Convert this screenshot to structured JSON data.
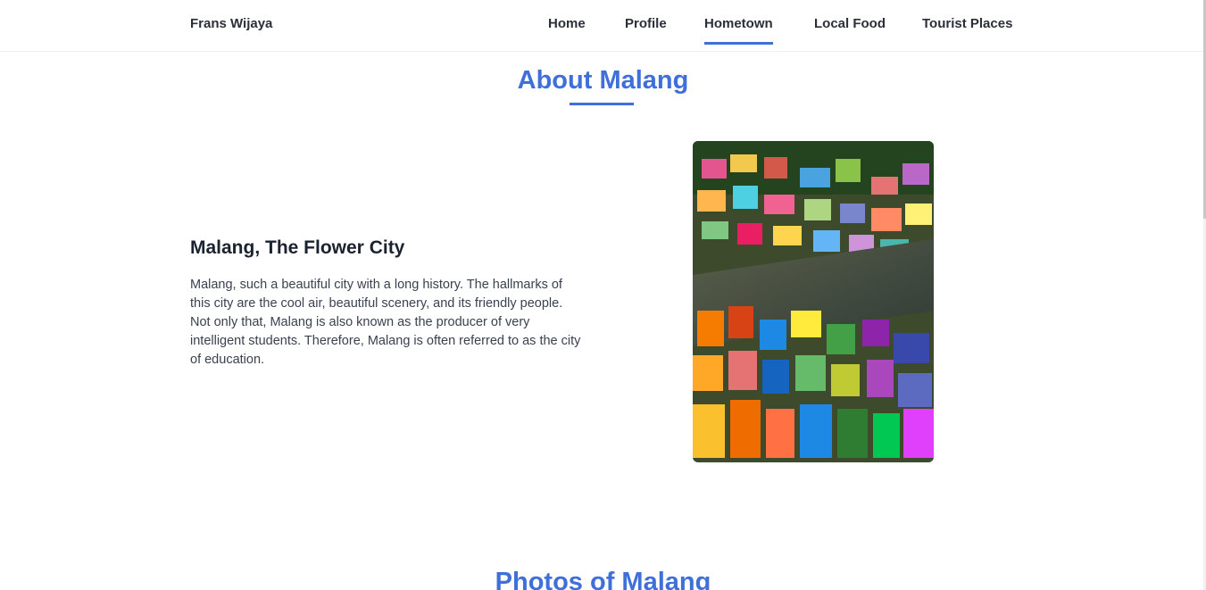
{
  "brand": "Frans Wijaya",
  "nav": {
    "items": [
      {
        "label": "Home",
        "active": false
      },
      {
        "label": "Profile",
        "active": false
      },
      {
        "label": "Hometown",
        "active": true
      },
      {
        "label": "Local Food",
        "active": false
      },
      {
        "label": "Tourist Places",
        "active": false
      }
    ]
  },
  "about": {
    "title": "About Malang",
    "heading": "Malang, The Flower City",
    "text": "Malang, such a beautiful city with a long history. The hallmarks of this city are the cool air, beautiful scenery, and its friendly people. Not only that, Malang is also known as the producer of very intelligent students. Therefore, Malang is often referred to as the city of education."
  },
  "photos": {
    "title": "Photos of Malang"
  },
  "colors": {
    "accent": "#3f6fd8",
    "text_dark": "#1b2230",
    "text_body": "#3a4150"
  }
}
